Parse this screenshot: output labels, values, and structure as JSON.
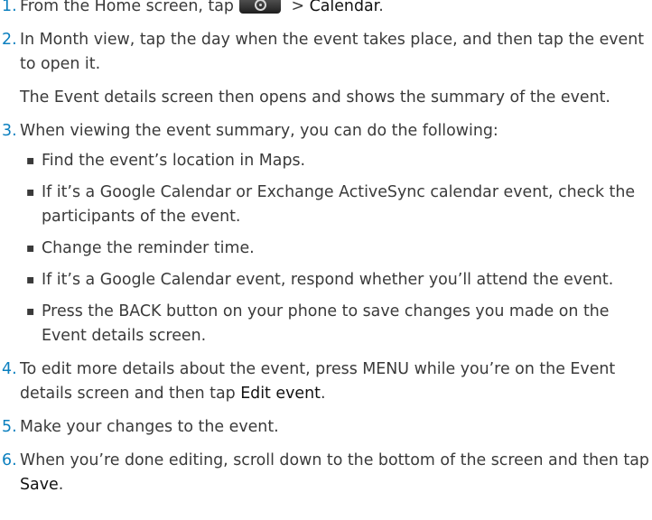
{
  "steps": [
    {
      "num": "1.",
      "before_icon": "From the Home screen, tap",
      "icon": "all-apps-icon",
      "after_icon": " > ",
      "term": "Calendar",
      "end": "."
    },
    {
      "num": "2.",
      "text": "In Month view, tap the day when the event takes place, and then tap the event to open it.",
      "subtext": "The Event details screen then opens and shows the summary of the event."
    },
    {
      "num": "3.",
      "text": "When viewing the event summary, you can do the following:",
      "bullets": [
        "Find the event’s location in Maps.",
        "If it’s a Google Calendar or Exchange ActiveSync calendar event, check the participants of the event.",
        "Change the reminder time.",
        "If it’s a Google Calendar event, respond whether you’ll attend the event.",
        "Press the BACK button on your phone to save changes you made on the Event details screen."
      ]
    },
    {
      "num": "4.",
      "before": "To edit more details about the event, press MENU while you’re on the Event details screen and then tap ",
      "term": "Edit event",
      "end": "."
    },
    {
      "num": "5.",
      "text": "Make your changes to the event."
    },
    {
      "num": "6.",
      "before": "When you’re done editing, scroll down to the bottom of the screen and then tap ",
      "term": "Save",
      "end": "."
    }
  ],
  "bullet_symbol": "▪"
}
